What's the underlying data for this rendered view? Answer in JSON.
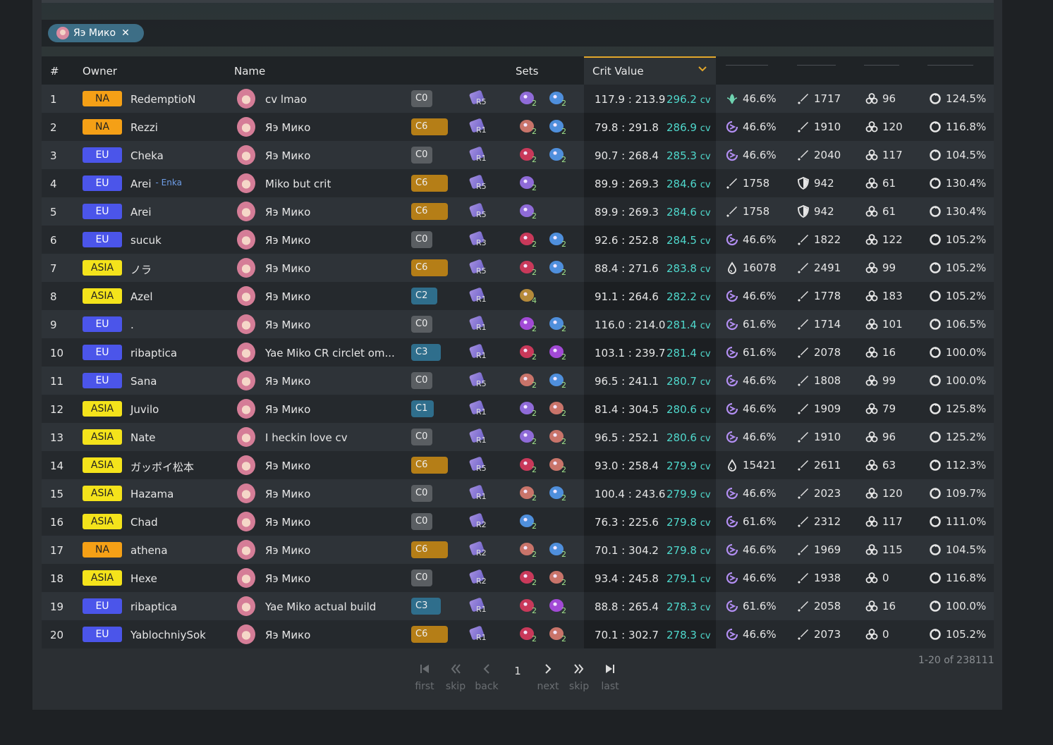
{
  "filter": {
    "chip_label": "Яэ Мико",
    "close_glyph": "✕"
  },
  "table": {
    "headers": {
      "rank": "#",
      "owner": "Owner",
      "name": "Name",
      "sets": "Sets",
      "crit_value": "Crit Value"
    },
    "sort_indicator": "chevron-down",
    "rows": [
      {
        "rank": "1",
        "region": "NA",
        "owner": "RedemptioN",
        "alt": "",
        "name": "cv lmao",
        "cons": "C0",
        "refine": "R5",
        "sets": [
          {
            "n": "2",
            "color": "#8f6bd8"
          },
          {
            "n": "2",
            "color": "#4f8fdc"
          }
        ],
        "ratio": "117.9 : 213.9",
        "cv": "296.2",
        "stats": [
          {
            "icon": "anemo",
            "v": "46.6%"
          },
          {
            "icon": "atk",
            "v": "1717"
          },
          {
            "icon": "em",
            "v": "96"
          },
          {
            "icon": "er",
            "v": "124.5%"
          }
        ]
      },
      {
        "rank": "2",
        "region": "NA",
        "owner": "Rezzi",
        "alt": "",
        "name": "Яэ Мико",
        "cons": "C6",
        "refine": "R1",
        "sets": [
          {
            "n": "2",
            "color": "#c9746a"
          },
          {
            "n": "2",
            "color": "#4f8fdc"
          }
        ],
        "ratio": "79.8 : 291.8",
        "cv": "286.9",
        "stats": [
          {
            "icon": "electro",
            "v": "46.6%"
          },
          {
            "icon": "atk",
            "v": "1910"
          },
          {
            "icon": "em",
            "v": "120"
          },
          {
            "icon": "er",
            "v": "116.8%"
          }
        ]
      },
      {
        "rank": "3",
        "region": "EU",
        "owner": "Cheka",
        "alt": "",
        "name": "Яэ Мико",
        "cons": "C0",
        "refine": "R1",
        "sets": [
          {
            "n": "2",
            "color": "#c9395a"
          },
          {
            "n": "2",
            "color": "#4f8fdc"
          }
        ],
        "ratio": "90.7 : 268.4",
        "cv": "285.3",
        "stats": [
          {
            "icon": "electro",
            "v": "46.6%"
          },
          {
            "icon": "atk",
            "v": "2040"
          },
          {
            "icon": "em",
            "v": "117"
          },
          {
            "icon": "er",
            "v": "104.5%"
          }
        ]
      },
      {
        "rank": "4",
        "region": "EU",
        "owner": "Arei",
        "alt": "Enka",
        "name": "Miko but crit",
        "cons": "C6",
        "refine": "R5",
        "sets": [
          {
            "n": "2",
            "color": "#8f6bd8"
          }
        ],
        "ratio": "89.9 : 269.3",
        "cv": "284.6",
        "stats": [
          {
            "icon": "atk",
            "v": "1758"
          },
          {
            "icon": "def",
            "v": "942"
          },
          {
            "icon": "em",
            "v": "61"
          },
          {
            "icon": "er",
            "v": "130.4%"
          }
        ]
      },
      {
        "rank": "5",
        "region": "EU",
        "owner": "Arei",
        "alt": "",
        "name": "Яэ Мико",
        "cons": "C6",
        "refine": "R5",
        "sets": [
          {
            "n": "2",
            "color": "#8f6bd8"
          }
        ],
        "ratio": "89.9 : 269.3",
        "cv": "284.6",
        "stats": [
          {
            "icon": "atk",
            "v": "1758"
          },
          {
            "icon": "def",
            "v": "942"
          },
          {
            "icon": "em",
            "v": "61"
          },
          {
            "icon": "er",
            "v": "130.4%"
          }
        ]
      },
      {
        "rank": "6",
        "region": "EU",
        "owner": "sucuk",
        "alt": "",
        "name": "Яэ Мико",
        "cons": "C0",
        "refine": "R3",
        "sets": [
          {
            "n": "2",
            "color": "#c9395a"
          },
          {
            "n": "2",
            "color": "#4f8fdc"
          }
        ],
        "ratio": "92.6 : 252.8",
        "cv": "284.5",
        "stats": [
          {
            "icon": "electro",
            "v": "46.6%"
          },
          {
            "icon": "atk",
            "v": "1822"
          },
          {
            "icon": "em",
            "v": "122"
          },
          {
            "icon": "er",
            "v": "105.2%"
          }
        ]
      },
      {
        "rank": "7",
        "region": "ASIA",
        "owner": "ノラ",
        "alt": "",
        "name": "Яэ Мико",
        "cons": "C6",
        "refine": "R5",
        "sets": [
          {
            "n": "2",
            "color": "#c9395a"
          },
          {
            "n": "2",
            "color": "#4f8fdc"
          }
        ],
        "ratio": "88.4 : 271.6",
        "cv": "283.8",
        "stats": [
          {
            "icon": "hp",
            "v": "16078"
          },
          {
            "icon": "atk",
            "v": "2491"
          },
          {
            "icon": "em",
            "v": "99"
          },
          {
            "icon": "er",
            "v": "105.2%"
          }
        ]
      },
      {
        "rank": "8",
        "region": "ASIA",
        "owner": "Azel",
        "alt": "",
        "name": "Яэ Мико",
        "cons": "C2",
        "refine": "R1",
        "sets": [
          {
            "n": "4",
            "color": "#b58a3a"
          }
        ],
        "ratio": "91.1 : 264.6",
        "cv": "282.2",
        "stats": [
          {
            "icon": "electro",
            "v": "46.6%"
          },
          {
            "icon": "atk",
            "v": "1778"
          },
          {
            "icon": "em",
            "v": "183"
          },
          {
            "icon": "er",
            "v": "105.2%"
          }
        ]
      },
      {
        "rank": "9",
        "region": "EU",
        "owner": ".",
        "alt": "",
        "name": "Яэ Мико",
        "cons": "C0",
        "refine": "R1",
        "sets": [
          {
            "n": "2",
            "color": "#a24ad6"
          },
          {
            "n": "2",
            "color": "#4f8fdc"
          }
        ],
        "ratio": "116.0 : 214.0",
        "cv": "281.4",
        "stats": [
          {
            "icon": "electro",
            "v": "61.6%"
          },
          {
            "icon": "atk",
            "v": "1714"
          },
          {
            "icon": "em",
            "v": "101"
          },
          {
            "icon": "er",
            "v": "106.5%"
          }
        ]
      },
      {
        "rank": "10",
        "region": "EU",
        "owner": "ribaptica",
        "alt": "",
        "name": "Yae Miko CR circlet om...",
        "cons": "C3",
        "refine": "R1",
        "sets": [
          {
            "n": "2",
            "color": "#c9395a"
          },
          {
            "n": "2",
            "color": "#a24ad6"
          }
        ],
        "ratio": "103.1 : 239.7",
        "cv": "281.4",
        "stats": [
          {
            "icon": "electro",
            "v": "61.6%"
          },
          {
            "icon": "atk",
            "v": "2078"
          },
          {
            "icon": "em",
            "v": "16"
          },
          {
            "icon": "er",
            "v": "100.0%"
          }
        ]
      },
      {
        "rank": "11",
        "region": "EU",
        "owner": "Sana",
        "alt": "",
        "name": "Яэ Мико",
        "cons": "C0",
        "refine": "R5",
        "sets": [
          {
            "n": "2",
            "color": "#c9746a"
          },
          {
            "n": "2",
            "color": "#4f8fdc"
          }
        ],
        "ratio": "96.5 : 241.1",
        "cv": "280.7",
        "stats": [
          {
            "icon": "electro",
            "v": "46.6%"
          },
          {
            "icon": "atk",
            "v": "1808"
          },
          {
            "icon": "em",
            "v": "99"
          },
          {
            "icon": "er",
            "v": "100.0%"
          }
        ]
      },
      {
        "rank": "12",
        "region": "ASIA",
        "owner": "Juvilo",
        "alt": "",
        "name": "Яэ Мико",
        "cons": "C1",
        "refine": "R1",
        "sets": [
          {
            "n": "2",
            "color": "#8f6bd8"
          },
          {
            "n": "2",
            "color": "#c9746a"
          }
        ],
        "ratio": "81.4 : 304.5",
        "cv": "280.6",
        "stats": [
          {
            "icon": "electro",
            "v": "46.6%"
          },
          {
            "icon": "atk",
            "v": "1909"
          },
          {
            "icon": "em",
            "v": "79"
          },
          {
            "icon": "er",
            "v": "125.8%"
          }
        ]
      },
      {
        "rank": "13",
        "region": "ASIA",
        "owner": "Nate",
        "alt": "",
        "name": "I heckin love cv",
        "cons": "C0",
        "refine": "R1",
        "sets": [
          {
            "n": "2",
            "color": "#8f6bd8"
          },
          {
            "n": "2",
            "color": "#c9746a"
          }
        ],
        "ratio": "96.5 : 252.1",
        "cv": "280.6",
        "stats": [
          {
            "icon": "electro",
            "v": "46.6%"
          },
          {
            "icon": "atk",
            "v": "1910"
          },
          {
            "icon": "em",
            "v": "96"
          },
          {
            "icon": "er",
            "v": "125.2%"
          }
        ]
      },
      {
        "rank": "14",
        "region": "ASIA",
        "owner": "ガッポイ松本",
        "alt": "",
        "name": "Яэ Мико",
        "cons": "C6",
        "refine": "R5",
        "sets": [
          {
            "n": "2",
            "color": "#c9395a"
          },
          {
            "n": "2",
            "color": "#c9746a"
          }
        ],
        "ratio": "93.0 : 258.4",
        "cv": "279.9",
        "stats": [
          {
            "icon": "hp",
            "v": "15421"
          },
          {
            "icon": "atk",
            "v": "2611"
          },
          {
            "icon": "em",
            "v": "63"
          },
          {
            "icon": "er",
            "v": "112.3%"
          }
        ]
      },
      {
        "rank": "15",
        "region": "ASIA",
        "owner": "Hazama",
        "alt": "",
        "name": "Яэ Мико",
        "cons": "C0",
        "refine": "R1",
        "sets": [
          {
            "n": "2",
            "color": "#c9746a"
          },
          {
            "n": "2",
            "color": "#4f8fdc"
          }
        ],
        "ratio": "100.4 : 243.6",
        "cv": "279.9",
        "stats": [
          {
            "icon": "electro",
            "v": "46.6%"
          },
          {
            "icon": "atk",
            "v": "2023"
          },
          {
            "icon": "em",
            "v": "120"
          },
          {
            "icon": "er",
            "v": "109.7%"
          }
        ]
      },
      {
        "rank": "16",
        "region": "ASIA",
        "owner": "Chad",
        "alt": "",
        "name": "Яэ Мико",
        "cons": "C0",
        "refine": "R2",
        "sets": [
          {
            "n": "2",
            "color": "#4f8fdc"
          }
        ],
        "ratio": "76.3 : 225.6",
        "cv": "279.8",
        "stats": [
          {
            "icon": "electro",
            "v": "61.6%"
          },
          {
            "icon": "atk",
            "v": "2312"
          },
          {
            "icon": "em",
            "v": "117"
          },
          {
            "icon": "er",
            "v": "111.0%"
          }
        ]
      },
      {
        "rank": "17",
        "region": "NA",
        "owner": "athena",
        "alt": "",
        "name": "Яэ Мико",
        "cons": "C6",
        "refine": "R2",
        "sets": [
          {
            "n": "2",
            "color": "#c9746a"
          },
          {
            "n": "2",
            "color": "#4f8fdc"
          }
        ],
        "ratio": "70.1 : 304.2",
        "cv": "279.8",
        "stats": [
          {
            "icon": "electro",
            "v": "46.6%"
          },
          {
            "icon": "atk",
            "v": "1969"
          },
          {
            "icon": "em",
            "v": "115"
          },
          {
            "icon": "er",
            "v": "104.5%"
          }
        ]
      },
      {
        "rank": "18",
        "region": "ASIA",
        "owner": "Hexe",
        "alt": "",
        "name": "Яэ Мико",
        "cons": "C0",
        "refine": "R2",
        "sets": [
          {
            "n": "2",
            "color": "#c9395a"
          },
          {
            "n": "2",
            "color": "#c9746a"
          }
        ],
        "ratio": "93.4 : 245.8",
        "cv": "279.1",
        "stats": [
          {
            "icon": "electro",
            "v": "46.6%"
          },
          {
            "icon": "atk",
            "v": "1938"
          },
          {
            "icon": "em",
            "v": "0"
          },
          {
            "icon": "er",
            "v": "116.8%"
          }
        ]
      },
      {
        "rank": "19",
        "region": "EU",
        "owner": "ribaptica",
        "alt": "",
        "name": "Yae Miko actual build",
        "cons": "C3",
        "refine": "R1",
        "sets": [
          {
            "n": "2",
            "color": "#c9395a"
          },
          {
            "n": "2",
            "color": "#a24ad6"
          }
        ],
        "ratio": "88.8 : 265.4",
        "cv": "278.3",
        "stats": [
          {
            "icon": "electro",
            "v": "61.6%"
          },
          {
            "icon": "atk",
            "v": "2058"
          },
          {
            "icon": "em",
            "v": "16"
          },
          {
            "icon": "er",
            "v": "100.0%"
          }
        ]
      },
      {
        "rank": "20",
        "region": "EU",
        "owner": "YablochniySok",
        "alt": "",
        "name": "Яэ Мико",
        "cons": "C6",
        "refine": "R1",
        "sets": [
          {
            "n": "2",
            "color": "#c9395a"
          },
          {
            "n": "2",
            "color": "#c9746a"
          }
        ],
        "ratio": "70.1 : 302.7",
        "cv": "278.3",
        "stats": [
          {
            "icon": "electro",
            "v": "46.6%"
          },
          {
            "icon": "atk",
            "v": "2073"
          },
          {
            "icon": "em",
            "v": "0"
          },
          {
            "icon": "er",
            "v": "105.2%"
          }
        ]
      }
    ],
    "cv_unit": "cv"
  },
  "pagination": {
    "first": "first",
    "skip_back": "skip",
    "back": "back",
    "page": "1",
    "next": "next",
    "skip_forward": "skip",
    "last": "last",
    "count": "1-20 of 238111"
  }
}
